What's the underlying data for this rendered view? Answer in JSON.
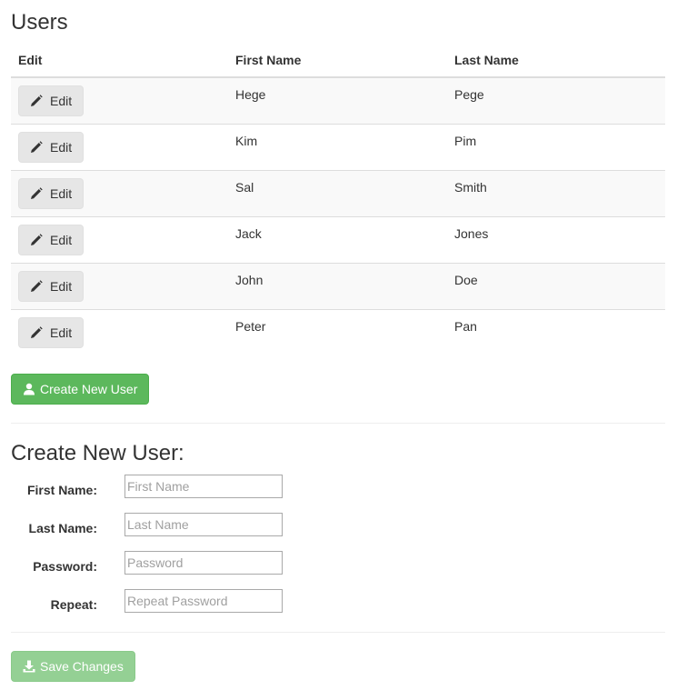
{
  "page": {
    "title": "Users"
  },
  "table": {
    "headers": {
      "edit": "Edit",
      "first": "First Name",
      "last": "Last Name"
    },
    "edit_label": "Edit",
    "rows": [
      {
        "first": "Hege",
        "last": "Pege"
      },
      {
        "first": "Kim",
        "last": "Pim"
      },
      {
        "first": "Sal",
        "last": "Smith"
      },
      {
        "first": "Jack",
        "last": "Jones"
      },
      {
        "first": "John",
        "last": "Doe"
      },
      {
        "first": "Peter",
        "last": "Pan"
      }
    ]
  },
  "create_button": {
    "label": "Create New User",
    "icon": "user-icon",
    "color": "#5cb85c"
  },
  "form": {
    "title": "Create New User:",
    "fields": {
      "first": {
        "label": "First Name:",
        "placeholder": "First Name",
        "value": ""
      },
      "last": {
        "label": "Last Name:",
        "placeholder": "Last Name",
        "value": ""
      },
      "password": {
        "label": "Password:",
        "placeholder": "Password",
        "value": ""
      },
      "repeat": {
        "label": "Repeat:",
        "placeholder": "Repeat Password",
        "value": ""
      }
    }
  },
  "save_button": {
    "label": "Save Changes",
    "icon": "download-icon",
    "state": "disabled"
  },
  "icons": {
    "edit": "pencil-icon"
  }
}
